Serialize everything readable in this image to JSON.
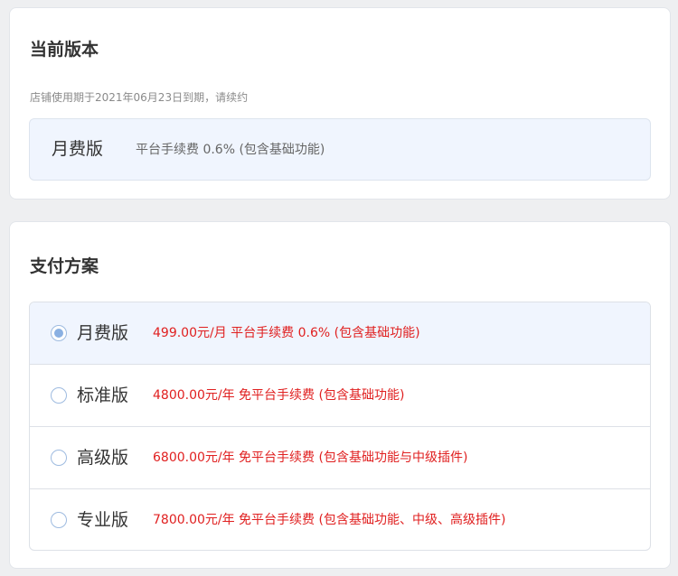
{
  "current_section": {
    "title": "当前版本",
    "expiry_note": "店铺使用期于2021年06月23日到期，请续约",
    "plan_name": "月费版",
    "plan_desc": "平台手续费 0.6% (包含基础功能)"
  },
  "payment_section": {
    "title": "支付方案",
    "selected_index": 0,
    "plans": [
      {
        "name": "月费版",
        "price": "499.00元/月 平台手续费 0.6% (包含基础功能)",
        "selected": true
      },
      {
        "name": "标准版",
        "price": "4800.00元/年 免平台手续费 (包含基础功能)",
        "selected": false
      },
      {
        "name": "高级版",
        "price": "6800.00元/年 免平台手续费 (包含基础功能与中级插件)",
        "selected": false
      },
      {
        "name": "专业版",
        "price": "7800.00元/年 免平台手续费 (包含基础功能、中级、高级插件)",
        "selected": false
      }
    ]
  },
  "colors": {
    "background": "#eeeff1",
    "highlight": "#f0f5fe",
    "price_red": "#e02020",
    "radio_accent": "#8ab0e2"
  }
}
